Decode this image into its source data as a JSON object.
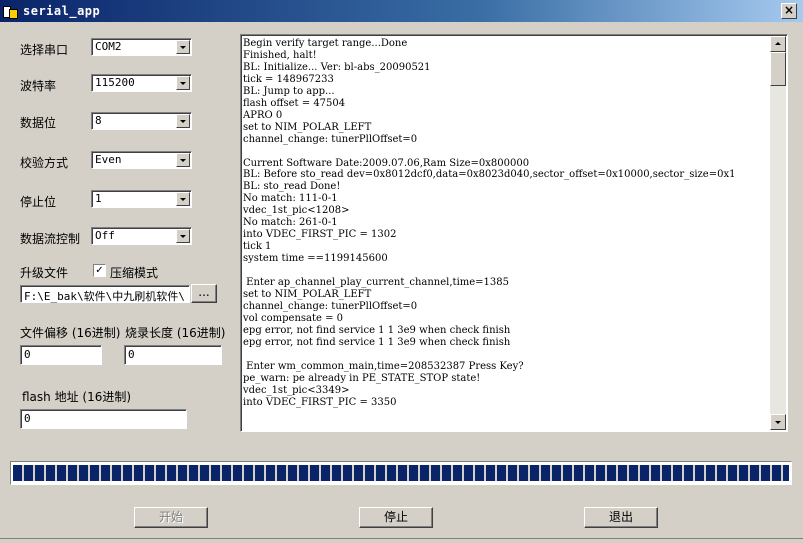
{
  "window": {
    "title": "serial_app",
    "close_glyph": "×",
    "icon": "serial-app-icon"
  },
  "settings": {
    "port": {
      "label": "选择串口",
      "value": "COM2"
    },
    "baud": {
      "label": "波特率",
      "value": "115200"
    },
    "databits": {
      "label": "数据位",
      "value": "8"
    },
    "parity": {
      "label": "校验方式",
      "value": "Even"
    },
    "stopbits": {
      "label": "停止位",
      "value": "1"
    },
    "flowcontrol": {
      "label": "数据流控制",
      "value": "Off"
    }
  },
  "upgrade": {
    "label": "升级文件",
    "compress_label": "压缩模式",
    "compress_checked": true,
    "check_glyph": "✓",
    "file_path": "F:\\E_bak\\软件\\中九刷机软件\\",
    "browse_label": "..."
  },
  "offsets": {
    "file_offset_label": "文件偏移 (16进制)",
    "file_offset_value": "0",
    "burn_length_label": "烧录长度 (16进制)",
    "burn_length_value": "0",
    "flash_addr_label": "flash 地址 (16进制)",
    "flash_addr_value": "0"
  },
  "log": {
    "lines": [
      "Begin verify target range...Done",
      "Finished, halt!",
      "BL: Initialize... Ver: bl-abs_20090521",
      "tick = 148967233",
      "BL: Jump to app...",
      "flash offset = 47504",
      "APRO 0",
      "set to NIM_POLAR_LEFT",
      "channel_change: tunerPllOffset=0",
      "",
      "Current Software Date:2009.07.06,Ram Size=0x800000",
      "BL: Before sto_read dev=0x8012dcf0,data=0x8023d040,sector_offset=0x10000,sector_size=0x1",
      "BL: sto_read Done!",
      "No match: 111-0-1",
      "vdec_1st_pic<1208>",
      "No match: 261-0-1",
      "into VDEC_FIRST_PIC = 1302",
      "tick 1",
      "system time ==1199145600",
      "",
      " Enter ap_channel_play_current_channel,time=1385",
      "set to NIM_POLAR_LEFT",
      "channel_change: tunerPllOffset=0",
      "vol compensate = 0",
      "epg error, not find service 1 1 3e9 when check finish",
      "epg error, not find service 1 1 3e9 when check finish",
      "",
      " Enter wm_common_main,time=208532387 Press Key?",
      "pe_warn: pe already in PE_STATE_STOP state!",
      "vdec_1st_pic<3349>",
      "into VDEC_FIRST_PIC = 3350"
    ]
  },
  "progress": {
    "fraction": 1.0
  },
  "buttons": {
    "start": "开始",
    "stop": "停止",
    "exit": "退出"
  }
}
